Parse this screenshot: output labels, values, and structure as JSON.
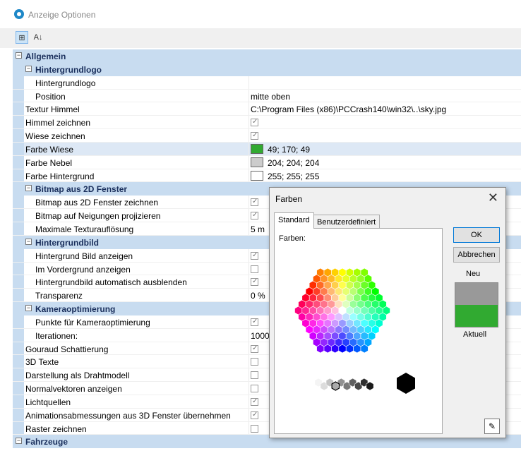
{
  "window": {
    "title": "Anzeige Optionen"
  },
  "toolbar": {
    "categorized_label": "⊞",
    "alpha_label": "A↓"
  },
  "grid_rows": [
    {
      "type": "cat",
      "level": 0,
      "label": "Allgemein"
    },
    {
      "type": "cat",
      "level": 1,
      "label": "Hintergrundlogo"
    },
    {
      "type": "text",
      "level": 2,
      "label": "Hintergrundlogo",
      "value": ""
    },
    {
      "type": "text",
      "level": 2,
      "label": "Position",
      "value": "mitte oben"
    },
    {
      "type": "text",
      "level": 1,
      "label": "Textur Himmel",
      "value": "C:\\Program Files (x86)\\PCCrash140\\win32\\..\\sky.jpg"
    },
    {
      "type": "check",
      "level": 1,
      "label": "Himmel zeichnen",
      "checked": true
    },
    {
      "type": "check",
      "level": 1,
      "label": "Wiese zeichnen",
      "checked": true
    },
    {
      "type": "color",
      "level": 1,
      "label": "Farbe Wiese",
      "value": "49; 170; 49",
      "swatch": "#31aa31",
      "selected": true
    },
    {
      "type": "color",
      "level": 1,
      "label": "Farbe Nebel",
      "value": "204; 204; 204",
      "swatch": "#cccccc"
    },
    {
      "type": "color",
      "level": 1,
      "label": "Farbe Hintergrund",
      "value": "255; 255; 255",
      "swatch": "#ffffff"
    },
    {
      "type": "cat",
      "level": 1,
      "label": "Bitmap aus 2D Fenster"
    },
    {
      "type": "check",
      "level": 2,
      "label": "Bitmap aus 2D Fenster zeichnen",
      "checked": true
    },
    {
      "type": "check",
      "level": 2,
      "label": "Bitmap auf Neigungen projizieren",
      "checked": true
    },
    {
      "type": "text",
      "level": 2,
      "label": "Maximale Texturauflösung",
      "value": "5 m"
    },
    {
      "type": "cat",
      "level": 1,
      "label": "Hintergrundbild"
    },
    {
      "type": "check",
      "level": 2,
      "label": "Hintergrund Bild anzeigen",
      "checked": true
    },
    {
      "type": "check",
      "level": 2,
      "label": "Im Vordergrund anzeigen",
      "checked": false
    },
    {
      "type": "check",
      "level": 2,
      "label": "Hintergrundbild automatisch ausblenden",
      "checked": true
    },
    {
      "type": "text",
      "level": 2,
      "label": "Transparenz",
      "value": "0 %"
    },
    {
      "type": "cat",
      "level": 1,
      "label": "Kameraoptimierung"
    },
    {
      "type": "check",
      "level": 2,
      "label": "Punkte für Kameraoptimierung",
      "checked": true
    },
    {
      "type": "text",
      "level": 2,
      "label": "Iterationen:",
      "value": "10000"
    },
    {
      "type": "check",
      "level": 1,
      "label": "Gouraud Schattierung",
      "checked": true
    },
    {
      "type": "check",
      "level": 1,
      "label": "3D Texte",
      "checked": false
    },
    {
      "type": "check",
      "level": 1,
      "label": "Darstellung als Drahtmodell",
      "checked": false
    },
    {
      "type": "check",
      "level": 1,
      "label": "Normalvektoren anzeigen",
      "checked": false
    },
    {
      "type": "check",
      "level": 1,
      "label": "Lichtquellen",
      "checked": true
    },
    {
      "type": "check",
      "level": 1,
      "label": "Animationsabmessungen aus 3D Fenster übernehmen",
      "checked": true
    },
    {
      "type": "check",
      "level": 1,
      "label": "Raster zeichnen",
      "checked": false
    },
    {
      "type": "cat",
      "level": 0,
      "label": "Fahrzeuge"
    }
  ],
  "dialog": {
    "title": "Farben",
    "close_label": "✕",
    "tabs": [
      "Standard",
      "Benutzerdefiniert"
    ],
    "colors_label": "Farben:",
    "ok_label": "OK",
    "cancel_label": "Abbrechen",
    "new_label": "Neu",
    "current_label": "Aktuell",
    "new_color": "#999999",
    "current_color": "#31aa31",
    "eyedropper_icon": "eyedropper-icon"
  }
}
